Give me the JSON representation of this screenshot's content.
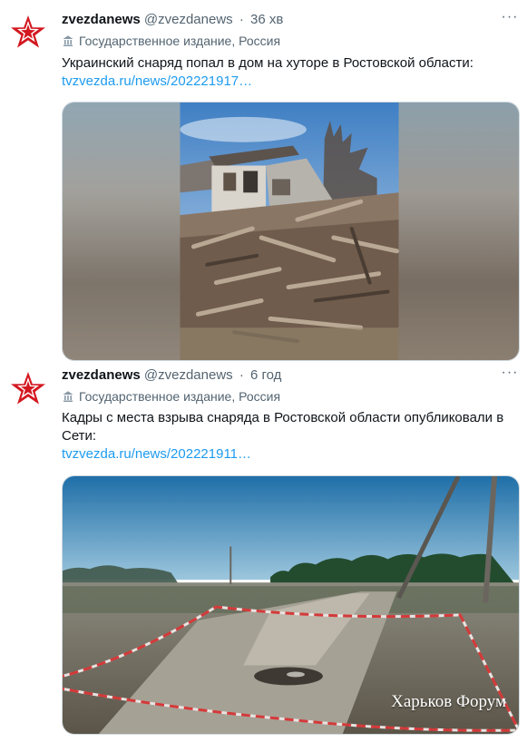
{
  "tweets": [
    {
      "author": {
        "name": "zvezdanews",
        "handle": "@zvezdanews",
        "avatar_icon": "red-star-icon"
      },
      "separator": "·",
      "time": "36 хв",
      "more_icon": "more-icon",
      "label_icon": "government-building-icon",
      "label": "Государственное издание, Россия",
      "text": "Украинский снаряд попал в дом на хуторе в Ростовской области:",
      "link": "tvzvezda.ru/news/202221917…",
      "media": {
        "kind": "photo",
        "alt_subject": "destroyed-house-rubble"
      }
    },
    {
      "author": {
        "name": "zvezdanews",
        "handle": "@zvezdanews",
        "avatar_icon": "red-star-icon"
      },
      "separator": "·",
      "time": "6 год",
      "more_icon": "more-icon",
      "label_icon": "government-building-icon",
      "label": "Государственное издание, Россия",
      "text": "Кадры с места взрыва снаряда в Ростовской области опубликовали в Сети:",
      "link": "tvzvezda.ru/news/202221911…",
      "media": {
        "kind": "photo",
        "alt_subject": "crater-on-dirt-road",
        "watermark": "Харьков Форум"
      }
    }
  ],
  "colors": {
    "text": "#0f1419",
    "secondary": "#536471",
    "link": "#1d9bf0",
    "star_red": "#d3171f"
  }
}
